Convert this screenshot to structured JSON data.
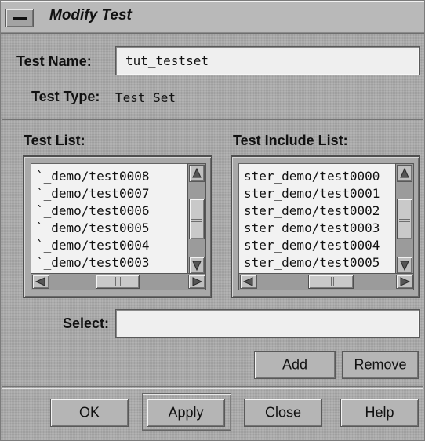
{
  "window": {
    "title": "Modify Test"
  },
  "fields": {
    "test_name_label": "Test Name:",
    "test_name_value": "tut_testset",
    "test_type_label": "Test Type:",
    "test_type_value": "Test Set",
    "select_label": "Select:",
    "select_value": ""
  },
  "lists": {
    "test_list_label": "Test List:",
    "test_list_items": [
      "`_demo/test0008",
      "`_demo/test0007",
      "`_demo/test0006",
      "`_demo/test0005",
      "`_demo/test0004",
      "`_demo/test0003"
    ],
    "include_list_label": "Test Include List:",
    "include_list_items": [
      "ster_demo/test0000",
      "ster_demo/test0001",
      "ster_demo/test0002",
      "ster_demo/test0003",
      "ster_demo/test0004",
      "ster_demo/test0005"
    ]
  },
  "buttons": {
    "add": "Add",
    "remove": "Remove",
    "ok": "OK",
    "apply": "Apply",
    "close": "Close",
    "help": "Help"
  },
  "icons": {
    "window_menu": "window-menu-icon",
    "arrow_up": "arrow-up-icon",
    "arrow_down": "arrow-down-icon",
    "arrow_left": "arrow-left-icon",
    "arrow_right": "arrow-right-icon"
  }
}
